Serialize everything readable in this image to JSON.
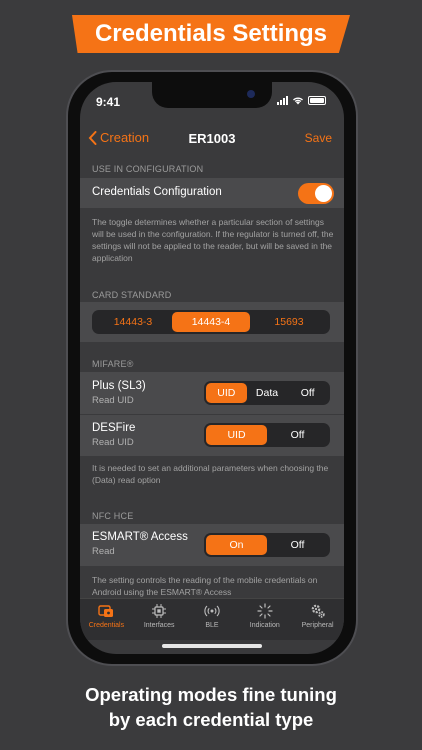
{
  "banner": {
    "title": "Credentials Settings"
  },
  "status": {
    "time": "9:41"
  },
  "nav": {
    "back_label": "Creation",
    "title": "ER1003",
    "save_label": "Save"
  },
  "use_in_config": {
    "section": "USE IN CONFIGURATION",
    "label": "Credentials Configuration",
    "enabled": true,
    "description": "The toggle determines whether a particular section of settings will be used in the configuration. If the regulator is turned off, the settings will not be applied to the reader, but will be saved in the application"
  },
  "card_standard": {
    "section": "CARD STANDARD",
    "options": [
      "14443-3",
      "14443-4",
      "15693"
    ],
    "selected": "14443-4"
  },
  "mifare": {
    "section": "MIFARE®",
    "plus": {
      "title": "Plus (SL3)",
      "subtitle": "Read UID",
      "options": [
        "UID",
        "Data",
        "Off"
      ],
      "selected": "UID"
    },
    "desfire": {
      "title": "DESFire",
      "subtitle": "Read UID",
      "options": [
        "UID",
        "Off"
      ],
      "selected": "UID"
    },
    "description": "It is needed to set an additional parameters when choosing the (Data) read option"
  },
  "nfc_hce": {
    "section": "NFC HCE",
    "esmart": {
      "title": "ESMART® Access",
      "subtitle": "Read",
      "options": [
        "On",
        "Off"
      ],
      "selected": "On"
    },
    "description": "The setting controls the reading of the mobile credentials on Android using the ESMART® Access"
  },
  "tabs": [
    {
      "label": "Credentials",
      "icon": "credentials-icon",
      "active": true
    },
    {
      "label": "Interfaces",
      "icon": "chip-icon",
      "active": false
    },
    {
      "label": "BLE",
      "icon": "ble-icon",
      "active": false
    },
    {
      "label": "Indication",
      "icon": "indication-icon",
      "active": false
    },
    {
      "label": "Peripheral",
      "icon": "gears-icon",
      "active": false
    }
  ],
  "caption": {
    "line1": "Operating modes fine tuning",
    "line2": "by each credential type"
  },
  "colors": {
    "accent": "#f57316",
    "background": "#3b3b3d",
    "row": "#4a4a4c"
  }
}
